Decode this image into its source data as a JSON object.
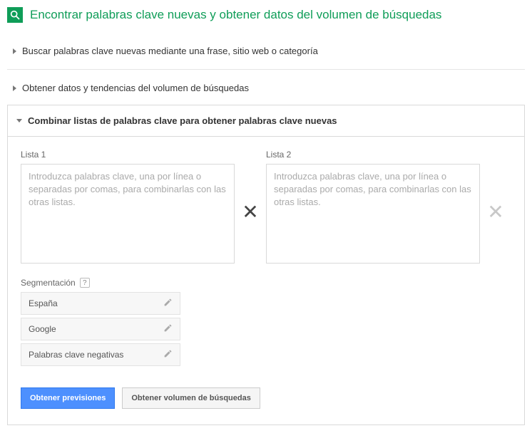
{
  "header": {
    "title": "Encontrar palabras clave nuevas y obtener datos del volumen de búsquedas"
  },
  "accordion": {
    "item1": "Buscar palabras clave nuevas mediante una frase, sitio web o categoría",
    "item2": "Obtener datos y tendencias del volumen de búsquedas",
    "item3": "Combinar listas de palabras clave para obtener palabras clave nuevas"
  },
  "lists": {
    "list1_label": "Lista 1",
    "list2_label": "Lista 2",
    "placeholder": "Introduzca palabras clave, una por línea o separadas por comas, para combinarlas con las otras listas."
  },
  "segmentation": {
    "title": "Segmentación",
    "help": "?",
    "rows": {
      "r0": "España",
      "r1": "Google",
      "r2": "Palabras clave negativas"
    }
  },
  "buttons": {
    "primary": "Obtener previsiones",
    "secondary": "Obtener volumen de búsquedas"
  }
}
